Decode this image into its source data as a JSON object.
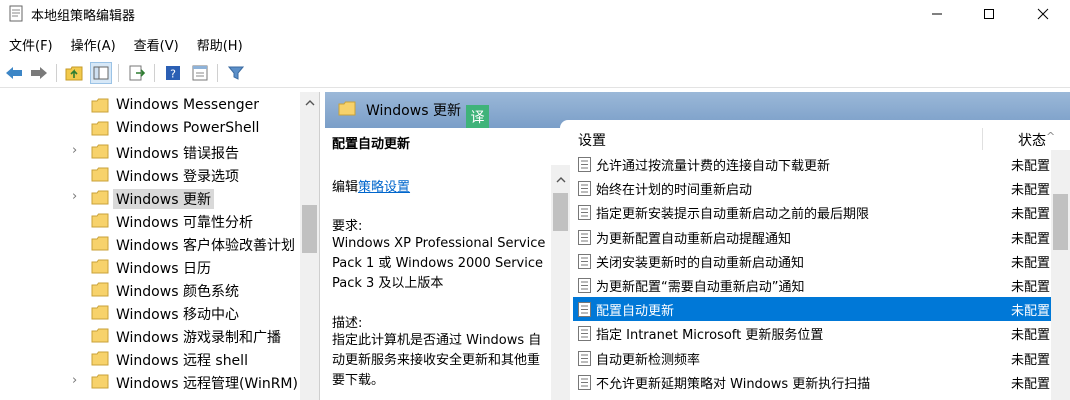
{
  "window": {
    "title": "本地组策略编辑器"
  },
  "menu": {
    "items": [
      "文件(F)",
      "操作(A)",
      "查看(V)",
      "帮助(H)"
    ]
  },
  "toolbar": {
    "icons": [
      "back-icon",
      "forward-icon",
      "up-folder-icon",
      "show-hide-tree-icon",
      "export-list-icon",
      "help-icon",
      "properties-icon",
      "filter-icon"
    ]
  },
  "tree": {
    "items": [
      {
        "label": "Windows Messenger",
        "expandable": false
      },
      {
        "label": "Windows PowerShell",
        "expandable": false
      },
      {
        "label": "Windows 错误报告",
        "expandable": true
      },
      {
        "label": "Windows 登录选项",
        "expandable": false
      },
      {
        "label": "Windows 更新",
        "expandable": true,
        "selected": true
      },
      {
        "label": "Windows 可靠性分析",
        "expandable": false
      },
      {
        "label": "Windows 客户体验改善计划",
        "expandable": false
      },
      {
        "label": "Windows 日历",
        "expandable": false
      },
      {
        "label": "Windows 颜色系统",
        "expandable": false
      },
      {
        "label": "Windows 移动中心",
        "expandable": false
      },
      {
        "label": "Windows 游戏录制和广播",
        "expandable": false
      },
      {
        "label": "Windows 远程 shell",
        "expandable": false
      },
      {
        "label": "Windows 远程管理(WinRM)",
        "expandable": true
      }
    ]
  },
  "right": {
    "folder_title": "Windows 更新",
    "translate_badge": "译",
    "description": {
      "title": "配置自动更新",
      "edit_prefix": "编辑",
      "edit_link": "策略设置",
      "requirements_label": "要求:",
      "requirements": "Windows XP Professional Service Pack 1 或 Windows 2000 Service Pack 3 及以上版本",
      "description_label": "描述:",
      "description": "指定此计算机是否通过 Windows 自动更新服务来接收安全更新和其他重要下载。"
    },
    "list": {
      "col_setting": "设置",
      "col_state": "状态",
      "rows": [
        {
          "name": "允许通过按流量计费的连接自动下载更新",
          "state": "未配置"
        },
        {
          "name": "始终在计划的时间重新启动",
          "state": "未配置"
        },
        {
          "name": "指定更新安装提示自动重新启动之前的最后期限",
          "state": "未配置"
        },
        {
          "name": "为更新配置自动重新启动提醒通知",
          "state": "未配置"
        },
        {
          "name": "关闭安装更新时的自动重新启动通知",
          "state": "未配置"
        },
        {
          "name": "为更新配置“需要自动重新启动”通知",
          "state": "未配置"
        },
        {
          "name": "配置自动更新",
          "state": "未配置",
          "selected": true
        },
        {
          "name": "指定 Intranet Microsoft 更新服务位置",
          "state": "未配置"
        },
        {
          "name": "自动更新检测频率",
          "state": "未配置"
        },
        {
          "name": "不允许更新延期策略对 Windows 更新执行扫描",
          "state": "未配置"
        }
      ]
    }
  }
}
